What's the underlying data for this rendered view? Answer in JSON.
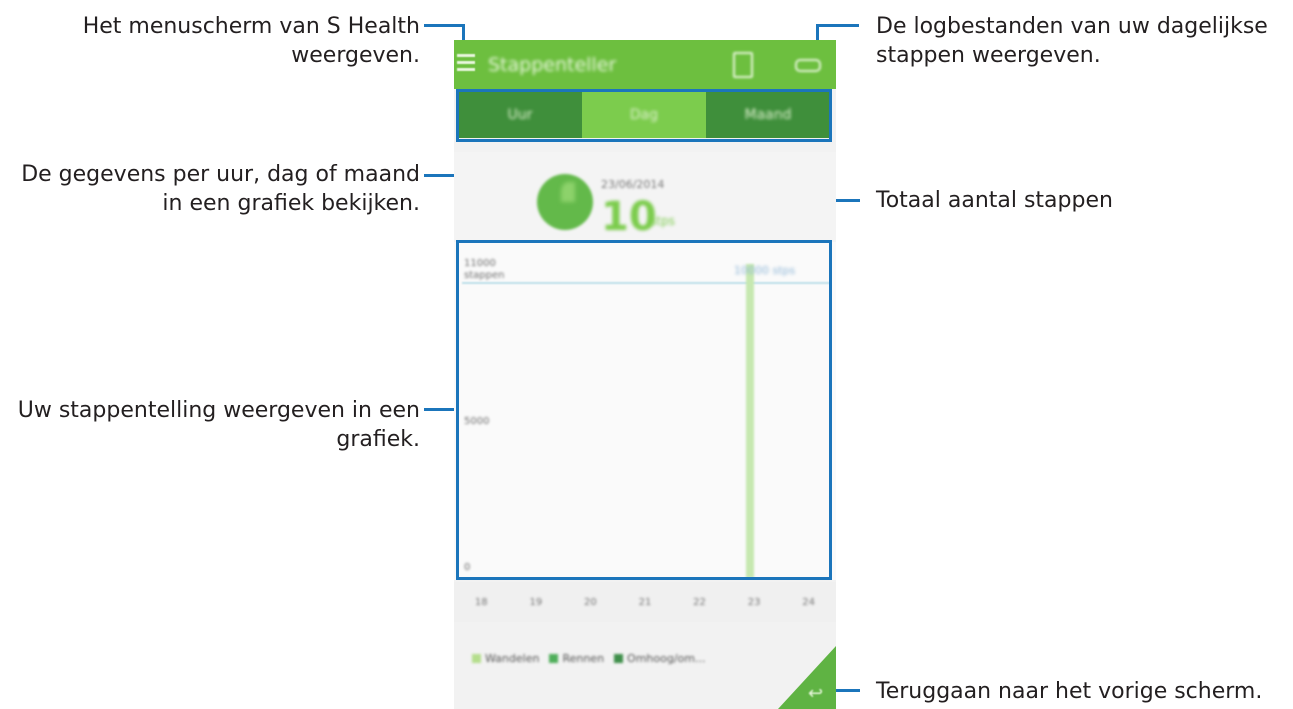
{
  "app": {
    "title": "Stappenteller",
    "tabs": [
      {
        "label": "Uur"
      },
      {
        "label": "Dag"
      },
      {
        "label": "Maand"
      }
    ],
    "summary": {
      "date": "23/06/2014",
      "steps": "10",
      "unit": "stps"
    },
    "chart": {
      "y_labels": [
        "11000 stappen",
        "5000",
        "0"
      ],
      "goal_label": "10000 stps",
      "x_labels": [
        "18",
        "19",
        "20",
        "21",
        "22",
        "23",
        "24"
      ]
    },
    "legend": [
      {
        "label": "Wandelen",
        "color": "#b4de8c"
      },
      {
        "label": "Rennen",
        "color": "#4fae5a"
      },
      {
        "label": "Omhoog/om...",
        "color": "#3f8f4a"
      }
    ]
  },
  "icons": {
    "menu": "hamburger-icon",
    "log": "log-icon",
    "more": "more-icon",
    "back": "back-arrow-icon"
  },
  "callouts": {
    "menu": "Het menuscherm van S Health weergeven.",
    "logs": "De logbestanden van uw dagelijkse stappen weergeven.",
    "tabs": "De gegevens per uur, dag of maand in een grafiek bekijken.",
    "total": "Totaal aantal stappen",
    "graph": "Uw stappentelling weergeven in een grafiek.",
    "back": "Teruggaan naar het vorige scherm."
  }
}
